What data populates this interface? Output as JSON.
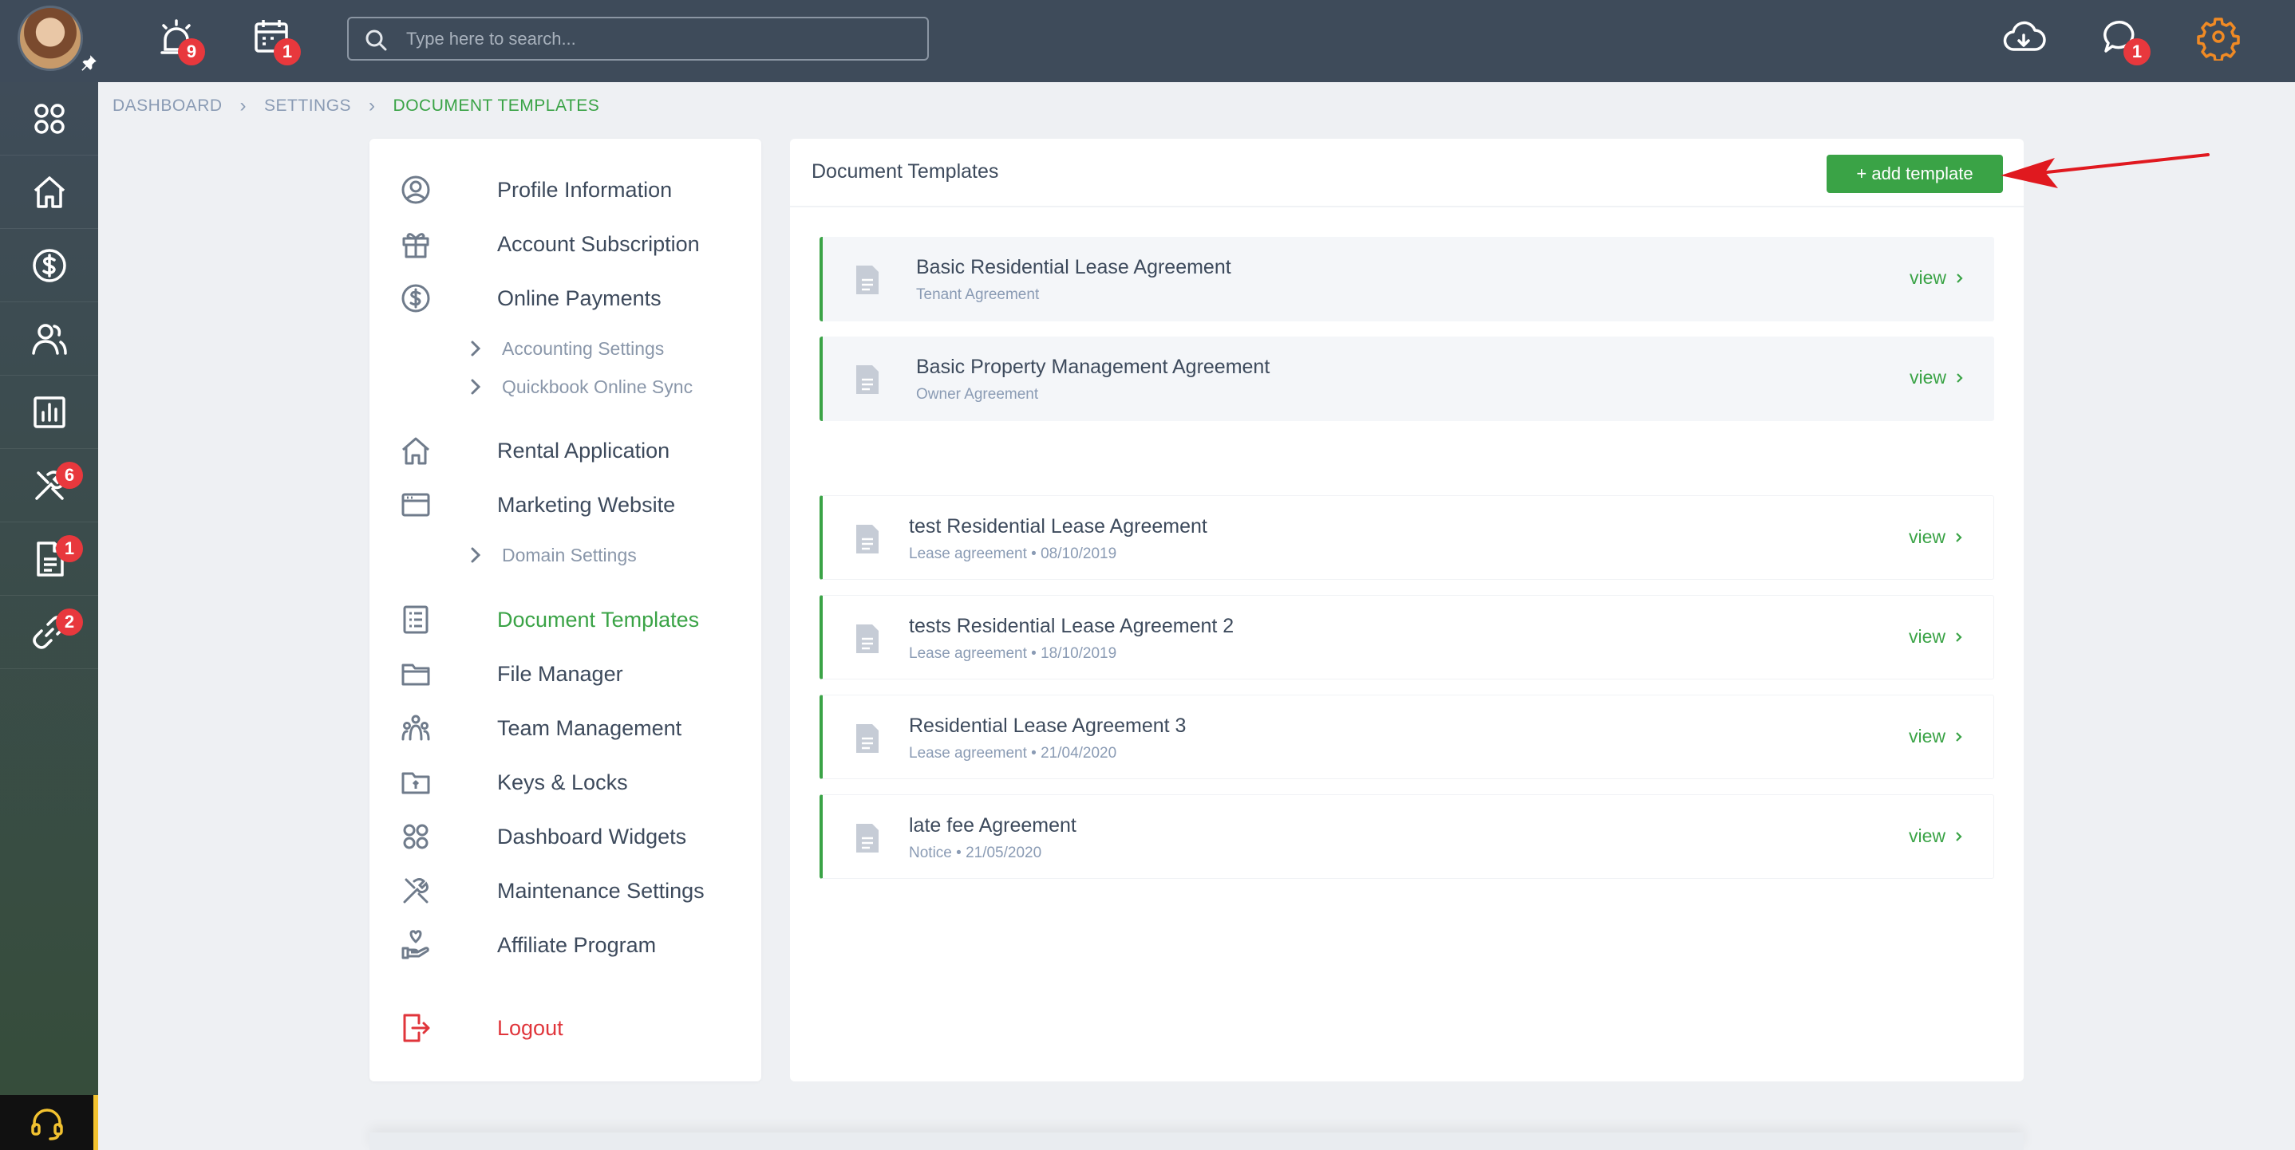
{
  "topbar": {
    "search_placeholder": "Type here to search...",
    "alarm_badge": "9",
    "calendar_badge": "1",
    "chat_badge": "1"
  },
  "sidebar": {
    "items": [
      {
        "name": "widgets",
        "badge": ""
      },
      {
        "name": "home",
        "badge": ""
      },
      {
        "name": "payments",
        "badge": ""
      },
      {
        "name": "people",
        "badge": ""
      },
      {
        "name": "reports",
        "badge": ""
      },
      {
        "name": "maintenance",
        "badge": "6"
      },
      {
        "name": "documents",
        "badge": "1"
      },
      {
        "name": "links",
        "badge": "2"
      }
    ]
  },
  "breadcrumb": {
    "items": [
      "DASHBOARD",
      "SETTINGS",
      "DOCUMENT TEMPLATES"
    ]
  },
  "settings_menu": {
    "profile": "Profile Information",
    "subscription": "Account Subscription",
    "online_payments": "Online Payments",
    "accounting_settings": "Accounting Settings",
    "quickbook_sync": "Quickbook Online Sync",
    "rental_application": "Rental Application",
    "marketing_website": "Marketing Website",
    "domain_settings": "Domain Settings",
    "document_templates": "Document Templates",
    "file_manager": "File Manager",
    "team_management": "Team Management",
    "keys_locks": "Keys & Locks",
    "dashboard_widgets": "Dashboard Widgets",
    "maintenance_settings": "Maintenance Settings",
    "affiliate_program": "Affiliate Program",
    "logout": "Logout"
  },
  "templates": {
    "title": "Document Templates",
    "add_label": "+ add template",
    "view_label": "view",
    "default": [
      {
        "name": "Basic Residential Lease Agreement",
        "sub": "Tenant Agreement"
      },
      {
        "name": "Basic Property Management Agreement",
        "sub": "Owner Agreement"
      }
    ],
    "custom": [
      {
        "name": "test Residential Lease Agreement",
        "sub": "Lease agreement • 08/10/2019"
      },
      {
        "name": "tests Residential Lease Agreement 2",
        "sub": "Lease agreement • 18/10/2019"
      },
      {
        "name": "Residential Lease Agreement 3",
        "sub": "Lease agreement • 21/04/2020"
      },
      {
        "name": "late fee Agreement",
        "sub": "Notice • 21/05/2020"
      }
    ]
  },
  "colors": {
    "accent": "#3aa346",
    "topbar": "#3e4b5a",
    "badge": "#e8383d",
    "logout": "#e0353b",
    "gear": "#f08a24",
    "annotation_arrow": "#e0191f"
  }
}
